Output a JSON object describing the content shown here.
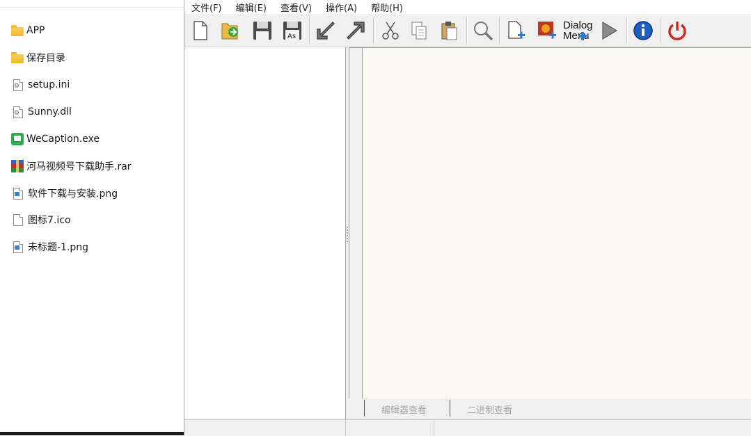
{
  "explorer": {
    "files": [
      {
        "name": "APP",
        "icon": "folder-icon"
      },
      {
        "name": "保存目录",
        "icon": "folder-icon"
      },
      {
        "name": "setup.ini",
        "icon": "settings-file-icon"
      },
      {
        "name": "Sunny.dll",
        "icon": "settings-file-icon"
      },
      {
        "name": "WeCaption.exe",
        "icon": "exe-icon"
      },
      {
        "name": "河马视频号下载助手.rar",
        "icon": "rar-archive-icon"
      },
      {
        "name": "软件下载与安装.png",
        "icon": "image-file-icon"
      },
      {
        "name": "图标7.ico",
        "icon": "blank-file-icon"
      },
      {
        "name": "未标题-1.png",
        "icon": "image-file-icon"
      }
    ]
  },
  "app": {
    "menu": [
      "文件(F)",
      "编辑(E)",
      "查看(V)",
      "操作(A)",
      "帮助(H)"
    ],
    "toolbar": {
      "dialog_menu_label_line1": "Dialog",
      "dialog_menu_label_line2": "Menu",
      "save_as_label": "As"
    },
    "bottom_tabs": [
      "编辑器查看",
      "二进制查看"
    ],
    "colors": {
      "editor_background": "#fdf9f3",
      "power_icon": "#d12a1f",
      "info_icon": "#1f5fbf"
    }
  }
}
